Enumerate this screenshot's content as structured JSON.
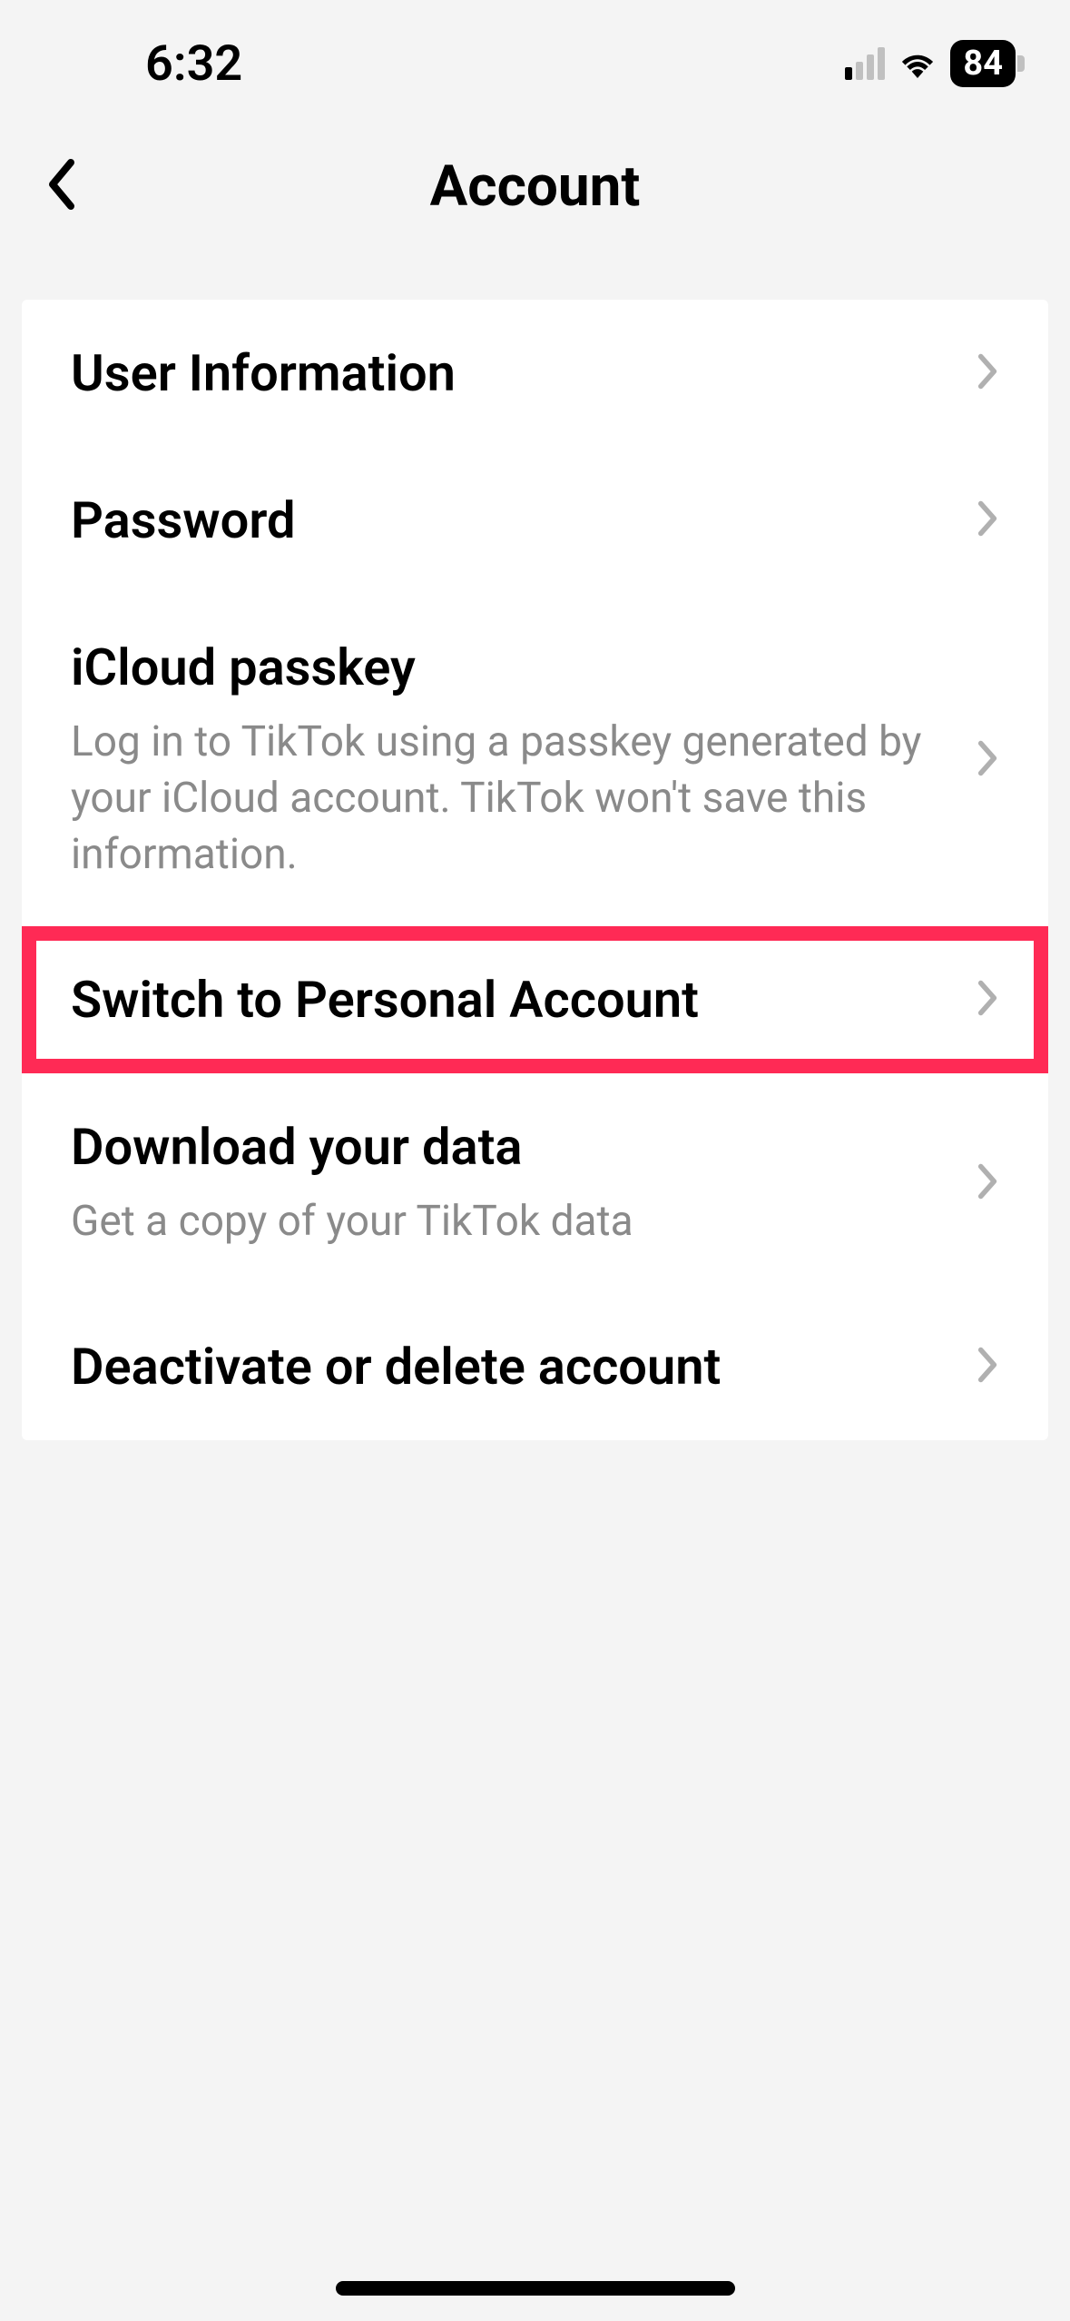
{
  "status": {
    "time": "6:32",
    "battery": "84"
  },
  "nav": {
    "title": "Account"
  },
  "items": [
    {
      "title": "User Information",
      "subtitle": null,
      "highlighted": false
    },
    {
      "title": "Password",
      "subtitle": null,
      "highlighted": false
    },
    {
      "title": "iCloud passkey",
      "subtitle": "Log in to TikTok using a passkey generated by your iCloud account. TikTok won't save this information.",
      "highlighted": false
    },
    {
      "title": "Switch to Personal Account",
      "subtitle": null,
      "highlighted": true
    },
    {
      "title": "Download your data",
      "subtitle": "Get a copy of your TikTok data",
      "highlighted": false
    },
    {
      "title": "Deactivate or delete account",
      "subtitle": null,
      "highlighted": false
    }
  ]
}
